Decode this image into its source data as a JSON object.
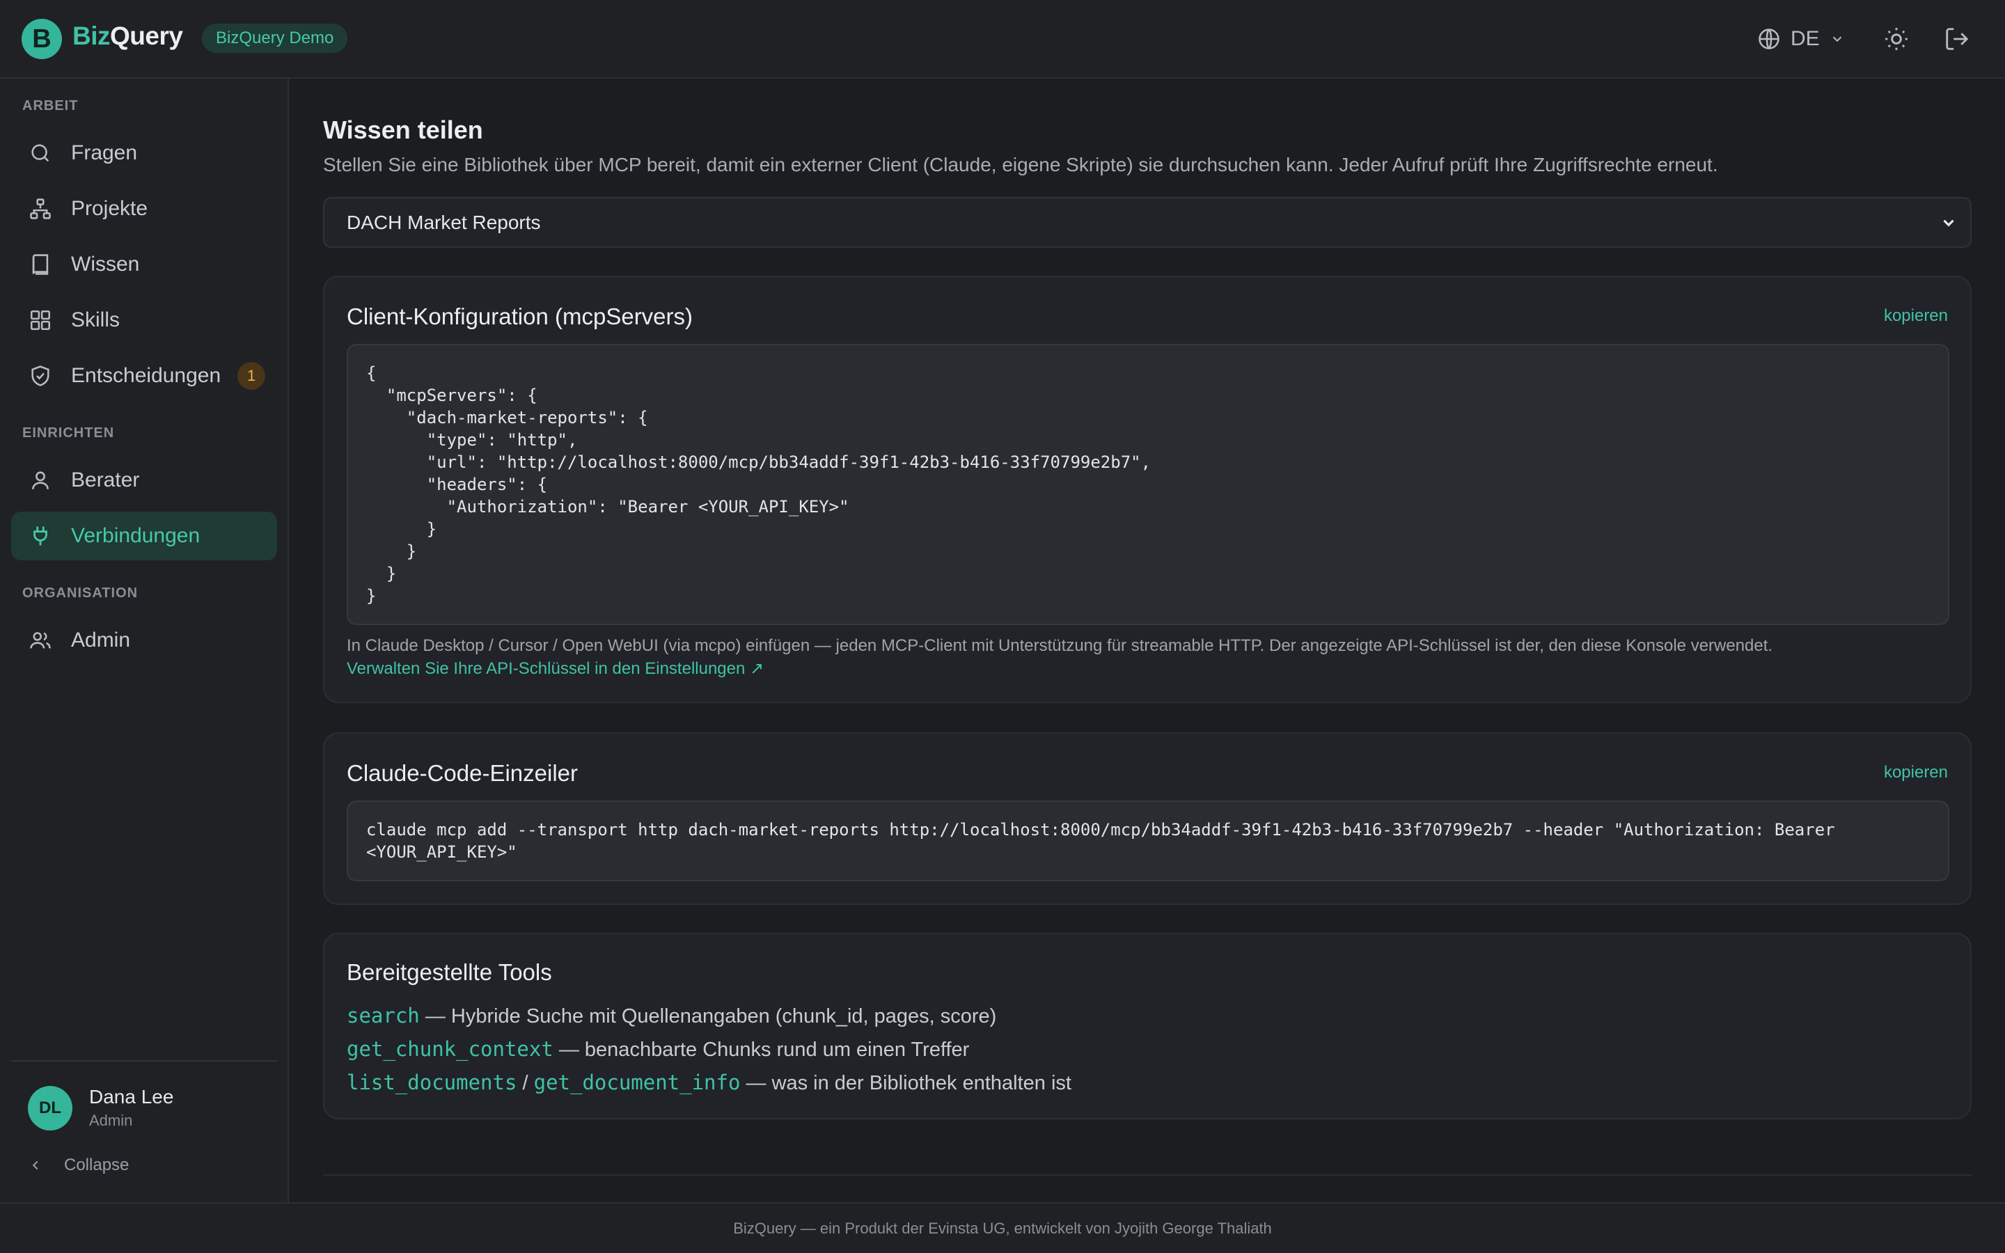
{
  "header": {
    "logo_letter": "B",
    "brand_part1": "Biz",
    "brand_part2": "Query",
    "demo_badge": "BizQuery Demo",
    "language": "DE"
  },
  "sidebar": {
    "sections": [
      {
        "label": "ARBEIT"
      },
      {
        "label": "EINRICHTEN"
      },
      {
        "label": "ORGANISATION"
      }
    ],
    "items": [
      {
        "label": "Fragen",
        "icon": "search-icon"
      },
      {
        "label": "Projekte",
        "icon": "sitemap-icon"
      },
      {
        "label": "Wissen",
        "icon": "book-icon"
      },
      {
        "label": "Skills",
        "icon": "grid-icon"
      },
      {
        "label": "Entscheidungen",
        "icon": "shield-check-icon",
        "badge": "1"
      },
      {
        "label": "Berater",
        "icon": "user-icon"
      },
      {
        "label": "Verbindungen",
        "icon": "plug-icon",
        "active": true
      },
      {
        "label": "Admin",
        "icon": "users-icon"
      }
    ],
    "user": {
      "initials": "DL",
      "name": "Dana Lee",
      "role": "Admin"
    },
    "collapse_label": "Collapse"
  },
  "main": {
    "title": "Wissen teilen",
    "subtitle": "Stellen Sie eine Bibliothek über MCP bereit, damit ein externer Client (Claude, eigene Skripte) sie durchsuchen kann. Jeder Aufruf prüft Ihre Zugriffsrechte erneut.",
    "library_select": "DACH Market Reports",
    "config_card": {
      "title": "Client-Konfiguration (mcpServers)",
      "copy_label": "kopieren",
      "code": "{\n  \"mcpServers\": {\n    \"dach-market-reports\": {\n      \"type\": \"http\",\n      \"url\": \"http://localhost:8000/mcp/bb34addf-39f1-42b3-b416-33f70799e2b7\",\n      \"headers\": {\n        \"Authorization\": \"Bearer <YOUR_API_KEY>\"\n      }\n    }\n  }\n}",
      "hint": "In Claude Desktop / Cursor / Open WebUI (via mcpo) einfügen — jeden MCP-Client mit Unterstützung für streamable HTTP. Der angezeigte API-Schlüssel ist der, den diese Konsole verwendet.",
      "link": "Verwalten Sie Ihre API-Schlüssel in den Einstellungen ↗"
    },
    "oneliner_card": {
      "title": "Claude-Code-Einzeiler",
      "copy_label": "kopieren",
      "code": "claude mcp add --transport http dach-market-reports http://localhost:8000/mcp/bb34addf-39f1-42b3-b416-33f70799e2b7 --header \"Authorization: Bearer\n<YOUR_API_KEY>\""
    },
    "tools_card": {
      "title": "Bereitgestellte Tools",
      "tools": [
        {
          "name": "search",
          "desc": " — Hybride Suche mit Quellenangaben (chunk_id, pages, score)"
        },
        {
          "name": "get_chunk_context",
          "desc": " — benachbarte Chunks rund um einen Treffer"
        },
        {
          "name": "list_documents",
          "sep": " / ",
          "name2": "get_document_info",
          "desc": " — was in der Bibliothek enthalten ist"
        }
      ]
    }
  },
  "footer": {
    "text": "BizQuery — ein Produkt der Evinsta UG, entwickelt von Jyojith George Thaliath"
  }
}
